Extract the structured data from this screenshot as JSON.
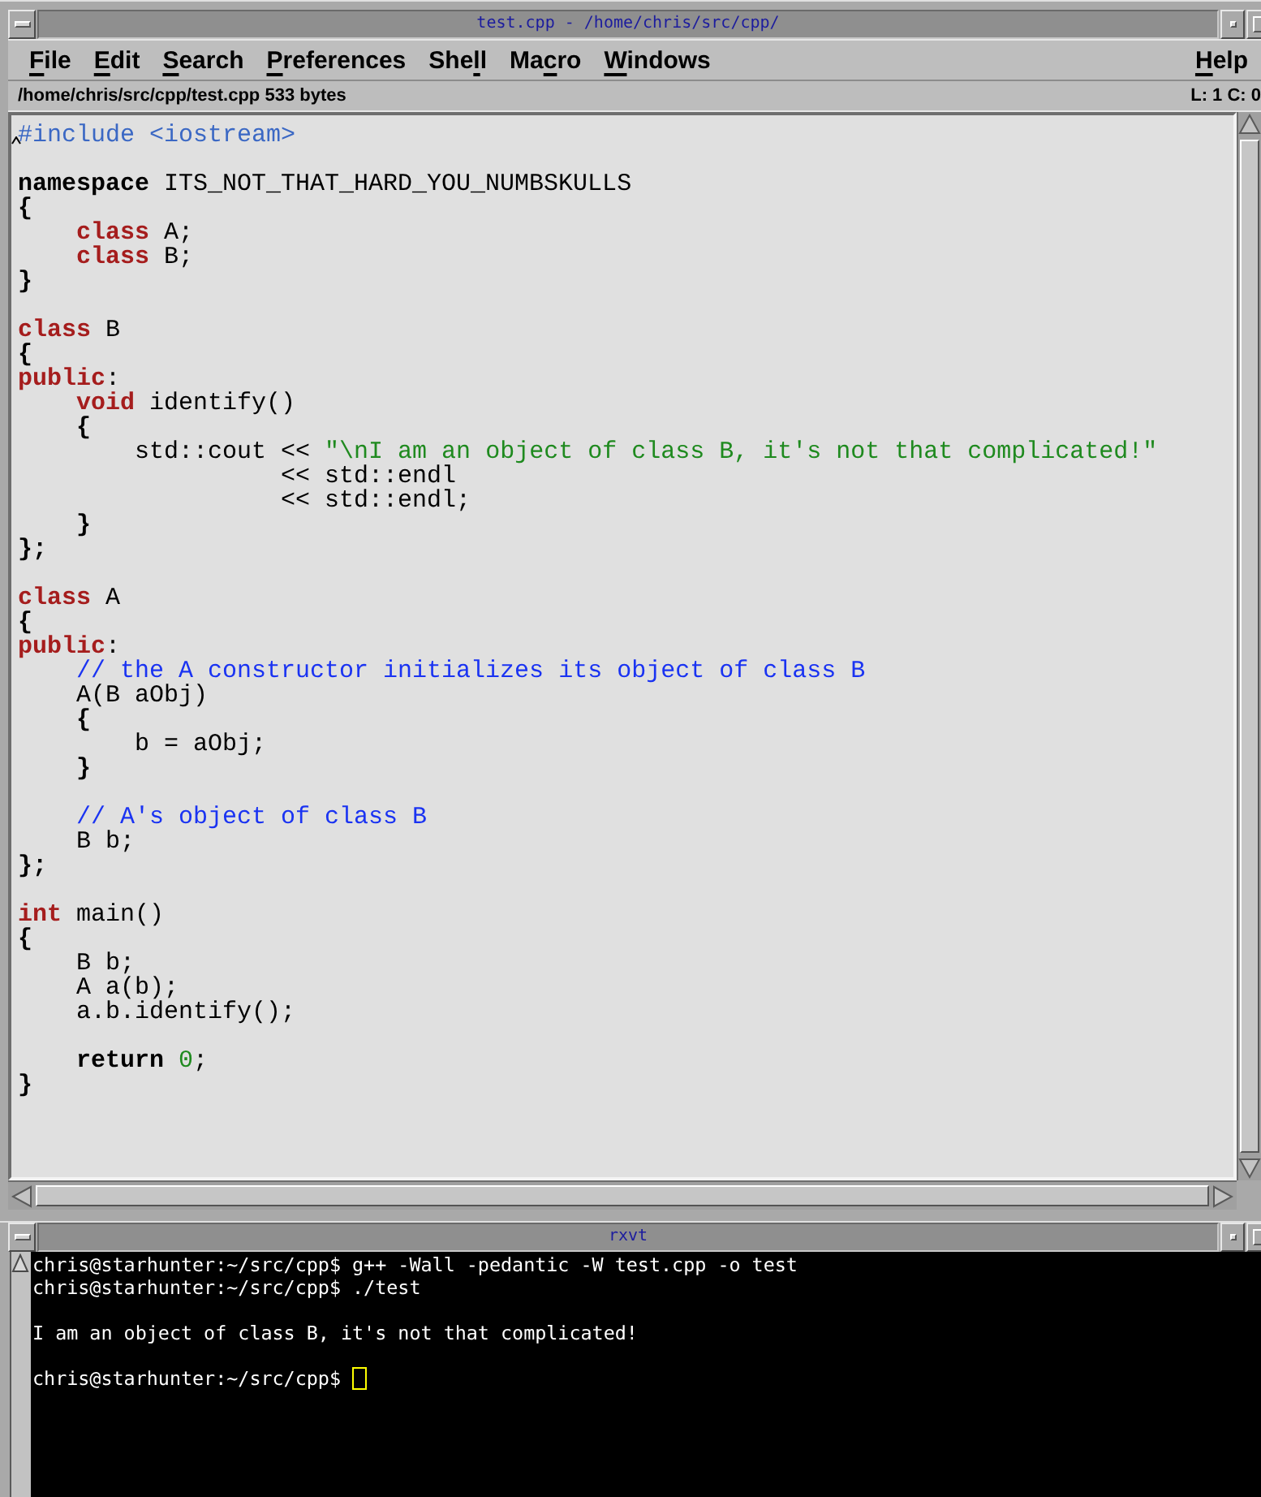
{
  "editor_window": {
    "title": "test.cpp - /home/chris/src/cpp/",
    "menu": [
      {
        "label_parts": [
          {
            "text": "F",
            "underlined": true
          },
          {
            "text": "ile",
            "underlined": false
          }
        ]
      },
      {
        "label_parts": [
          {
            "text": "E",
            "underlined": true
          },
          {
            "text": "dit",
            "underlined": false
          }
        ]
      },
      {
        "label_parts": [
          {
            "text": "S",
            "underlined": true
          },
          {
            "text": "earch",
            "underlined": false
          }
        ]
      },
      {
        "label_parts": [
          {
            "text": "P",
            "underlined": true
          },
          {
            "text": "references",
            "underlined": false
          }
        ]
      },
      {
        "label_parts": [
          {
            "text": "She",
            "underlined": false
          },
          {
            "text": "l",
            "underlined": true
          },
          {
            "text": "l",
            "underlined": false
          }
        ]
      },
      {
        "label_parts": [
          {
            "text": "Ma",
            "underlined": false
          },
          {
            "text": "c",
            "underlined": true
          },
          {
            "text": "ro",
            "underlined": false
          }
        ]
      },
      {
        "label_parts": [
          {
            "text": "W",
            "underlined": true
          },
          {
            "text": "indows",
            "underlined": false
          }
        ]
      }
    ],
    "help_menu": {
      "label_parts": [
        {
          "text": "H",
          "underlined": true
        },
        {
          "text": "elp",
          "underlined": false
        }
      ]
    },
    "status_bar": {
      "file_info": "/home/chris/src/cpp/test.cpp 533 bytes",
      "position": "L: 1 C: 0"
    },
    "code": [
      {
        "lines": [
          {
            "tokens": [
              {
                "kind": "preprocessor",
                "text": "#include <iostream>"
              }
            ]
          }
        ]
      },
      {
        "lines": [
          {
            "tokens": [
              {
                "kind": "keyword",
                "text": "namespace"
              },
              {
                "kind": "plain",
                "text": " ITS_NOT_THAT_HARD_YOU_NUMBSKULLS"
              }
            ]
          },
          {
            "tokens": [
              {
                "kind": "brace",
                "text": "{"
              }
            ]
          },
          {
            "tokens": [
              {
                "kind": "storage",
                "text": "    class"
              },
              {
                "kind": "plain",
                "text": " A;"
              }
            ]
          },
          {
            "tokens": [
              {
                "kind": "storage",
                "text": "    class"
              },
              {
                "kind": "plain",
                "text": " B;"
              }
            ]
          },
          {
            "tokens": [
              {
                "kind": "brace",
                "text": "}"
              }
            ]
          }
        ]
      },
      {
        "lines": [
          {
            "tokens": [
              {
                "kind": "storage",
                "text": "class"
              },
              {
                "kind": "plain",
                "text": " B"
              }
            ]
          },
          {
            "tokens": [
              {
                "kind": "brace",
                "text": "{"
              }
            ]
          },
          {
            "tokens": [
              {
                "kind": "storage",
                "text": "public"
              },
              {
                "kind": "plain",
                "text": ":"
              }
            ]
          },
          {
            "tokens": [
              {
                "kind": "storage",
                "text": "    void"
              },
              {
                "kind": "plain",
                "text": " identify()"
              }
            ]
          },
          {
            "tokens": [
              {
                "kind": "brace",
                "text": "    {"
              }
            ]
          },
          {
            "tokens": [
              {
                "kind": "plain",
                "text": "        std::cout << "
              },
              {
                "kind": "string",
                "text": "\"\\nI am an object of class B, it's not that complicated!\""
              }
            ]
          },
          {
            "tokens": [
              {
                "kind": "plain",
                "text": "                  << std::endl"
              }
            ]
          },
          {
            "tokens": [
              {
                "kind": "plain",
                "text": "                  << std::endl;"
              }
            ]
          },
          {
            "tokens": [
              {
                "kind": "brace",
                "text": "    }"
              }
            ]
          },
          {
            "tokens": [
              {
                "kind": "brace",
                "text": "};"
              }
            ]
          }
        ]
      },
      {
        "lines": [
          {
            "tokens": [
              {
                "kind": "storage",
                "text": "class"
              },
              {
                "kind": "plain",
                "text": " A"
              }
            ]
          },
          {
            "tokens": [
              {
                "kind": "brace",
                "text": "{"
              }
            ]
          },
          {
            "tokens": [
              {
                "kind": "storage",
                "text": "public"
              },
              {
                "kind": "plain",
                "text": ":"
              }
            ]
          },
          {
            "tokens": [
              {
                "kind": "comment",
                "text": "    // the A constructor initializes its object of class B"
              }
            ]
          },
          {
            "tokens": [
              {
                "kind": "plain",
                "text": "    A(B aObj)"
              }
            ]
          },
          {
            "tokens": [
              {
                "kind": "brace",
                "text": "    {"
              }
            ]
          },
          {
            "tokens": [
              {
                "kind": "plain",
                "text": "        b = aObj;"
              }
            ]
          },
          {
            "tokens": [
              {
                "kind": "brace",
                "text": "    }"
              }
            ]
          }
        ]
      },
      {
        "lines": [
          {
            "tokens": [
              {
                "kind": "comment",
                "text": "    // A's object of class B"
              }
            ]
          },
          {
            "tokens": [
              {
                "kind": "plain",
                "text": "    B b;"
              }
            ]
          },
          {
            "tokens": [
              {
                "kind": "brace",
                "text": "};"
              }
            ]
          }
        ]
      },
      {
        "lines": [
          {
            "tokens": [
              {
                "kind": "storage",
                "text": "int"
              },
              {
                "kind": "plain",
                "text": " main()"
              }
            ]
          },
          {
            "tokens": [
              {
                "kind": "brace",
                "text": "{"
              }
            ]
          },
          {
            "tokens": [
              {
                "kind": "plain",
                "text": "    B b;"
              }
            ]
          },
          {
            "tokens": [
              {
                "kind": "plain",
                "text": "    A a(b);"
              }
            ]
          },
          {
            "tokens": [
              {
                "kind": "plain",
                "text": "    a.b.identify();"
              }
            ]
          }
        ]
      },
      {
        "lines": [
          {
            "tokens": [
              {
                "kind": "keyword",
                "text": "    return"
              },
              {
                "kind": "number",
                "text": " 0"
              },
              {
                "kind": "plain",
                "text": ";"
              }
            ]
          },
          {
            "tokens": [
              {
                "kind": "brace",
                "text": "}"
              }
            ]
          }
        ]
      }
    ]
  },
  "terminal_window": {
    "title": "rxvt",
    "output": [
      {
        "lines": [
          {
            "text": "chris@starhunter:~/src/cpp$ g++ -Wall -pedantic -W test.cpp -o test",
            "cursor": false
          },
          {
            "text": "chris@starhunter:~/src/cpp$ ./test",
            "cursor": false
          }
        ]
      },
      {
        "lines": [
          {
            "text": "I am an object of class B, it's not that complicated!",
            "cursor": false
          }
        ]
      },
      {
        "lines": [
          {
            "text": "chris@starhunter:~/src/cpp$",
            "cursor": true
          }
        ]
      }
    ]
  }
}
